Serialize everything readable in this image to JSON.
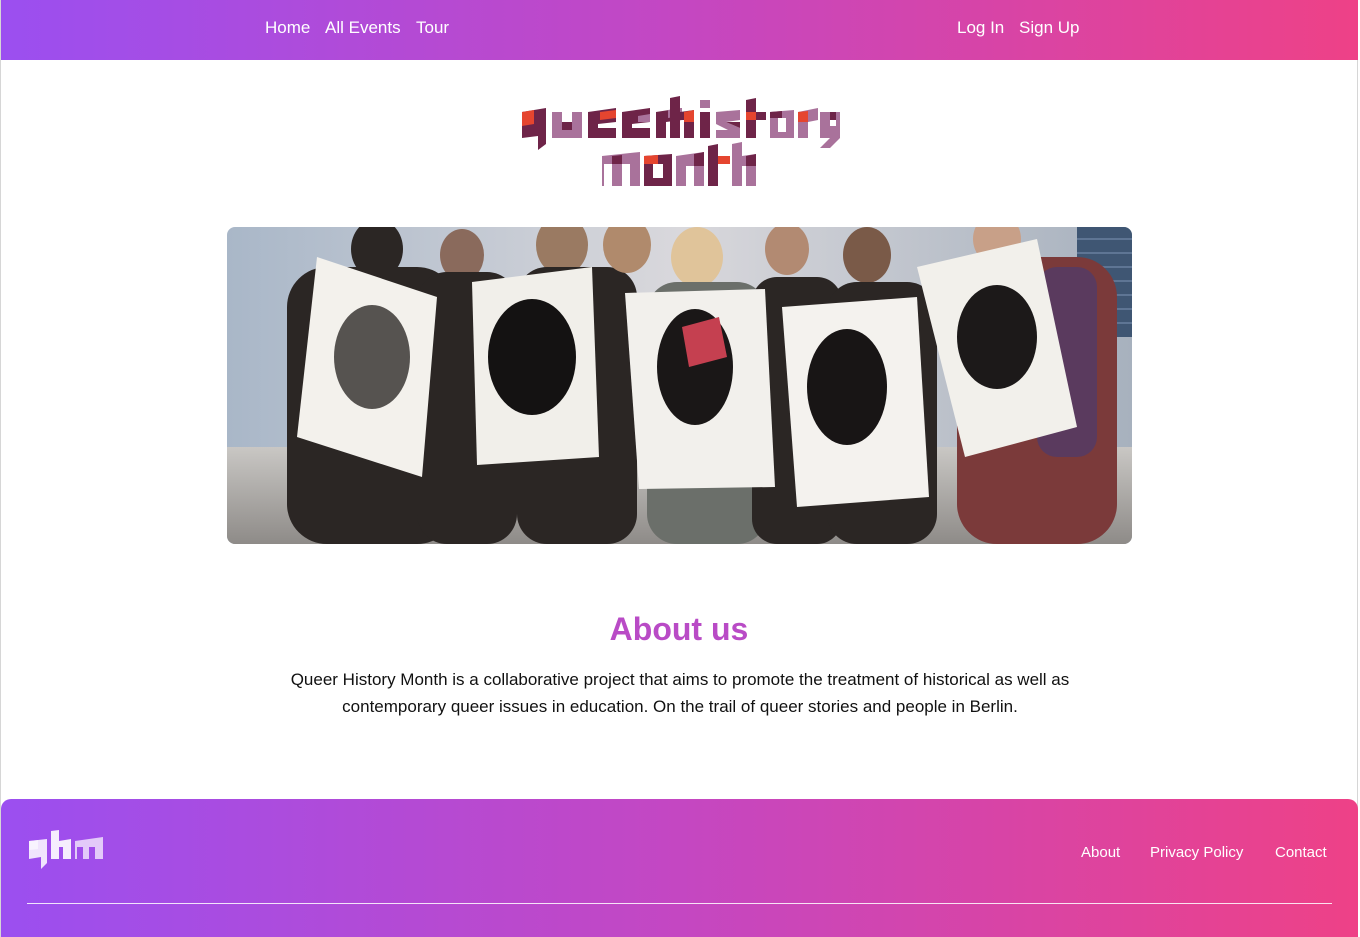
{
  "nav": {
    "left": [
      {
        "label": "Home"
      },
      {
        "label": "All Events"
      },
      {
        "label": "Tour"
      }
    ],
    "right": [
      {
        "label": "Log In"
      },
      {
        "label": "Sign Up"
      }
    ]
  },
  "logo": {
    "line1": "queer history",
    "line2": "month"
  },
  "hero": {
    "description": "photo-group-holding-stencil-portraits"
  },
  "about": {
    "title": "About us",
    "text": "Queer History Month is a collaborative project that aims to promote the treatment of historical as well as contemporary queer issues in education. On the trail of queer stories and people in Berlin."
  },
  "footer": {
    "logo_text": "qhm",
    "links": [
      {
        "label": "About"
      },
      {
        "label": "Privacy Policy"
      },
      {
        "label": "Contact"
      }
    ]
  },
  "colors": {
    "gradient_start": "#9b4ff0",
    "gradient_mid": "#c447c2",
    "gradient_end": "#ee4187",
    "heading": "#b94bc6",
    "logo_dark": "#6e2448",
    "logo_light": "#a9729b",
    "logo_accent": "#e5452f"
  }
}
